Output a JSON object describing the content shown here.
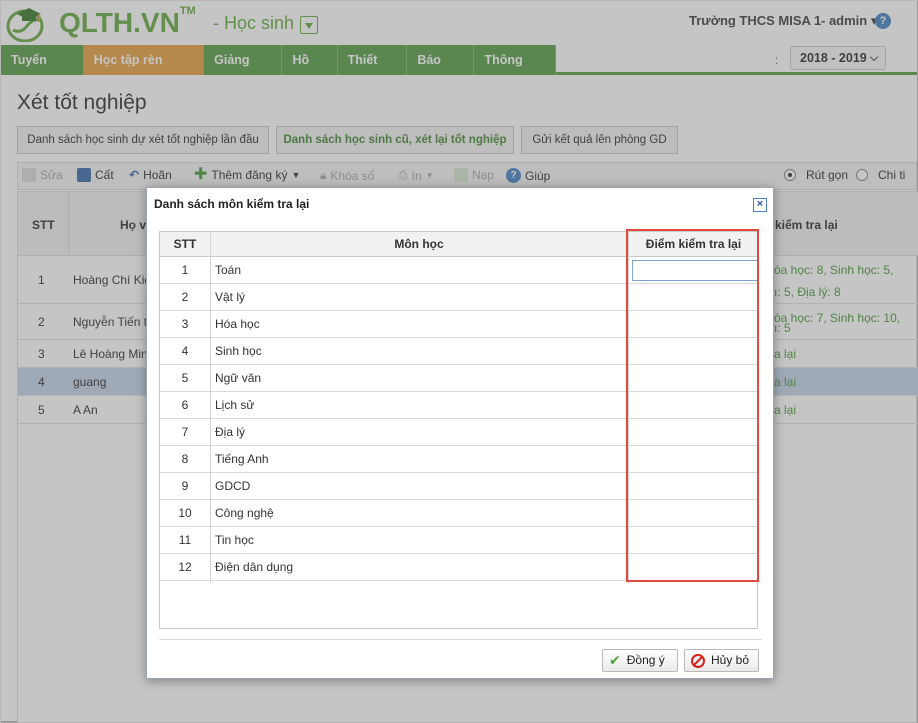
{
  "header": {
    "logo_text": "QLTH.VN",
    "logo_tm": "TM",
    "module": "- Học sinh",
    "school": "Trường THCS MISA 1",
    "user": "- admin ▾",
    "help": "?"
  },
  "nav": {
    "tabs": [
      "Tuyển sinh",
      "Học tập rèn luyện",
      "Giảng dạy",
      "Hồ sơ",
      "Thiết lập",
      "Báo cáo",
      "Thông báo"
    ],
    "active_index": 1,
    "year_colon": ":",
    "year": "2018 - 2019"
  },
  "page_title": "Xét tốt nghiệp",
  "top_buttons": [
    "Danh sách học sinh dự xét tốt nghiệp lần đầu",
    "Danh sách học sinh cũ, xét lại tốt nghiệp",
    "Gửi kết quả lên phòng GD"
  ],
  "toolbar": {
    "edit": "Sửa",
    "save": "Cất",
    "undo": "Hoãn",
    "add": "Thêm đăng ký",
    "lock": "Khóa số",
    "print": "In",
    "import": "Nạp",
    "help": "Giúp",
    "compact": "Rút gọn",
    "detail": "Chi ti"
  },
  "background_table": {
    "col_stt": "STT",
    "col_name": "Họ v",
    "col_exam": "kiểm tra lại",
    "rows": [
      {
        "stt": "1",
        "name": "Hoàng Chí Kiê",
        "exam_1": "óa học: 8, Sinh học: 5,",
        "exam_2": "ı: 5, Địa lý: 8"
      },
      {
        "stt": "2",
        "name": "Nguyễn Tiến t",
        "exam_1": "óa học: 7, Sinh học: 10,",
        "exam_2": "ı: 5"
      },
      {
        "stt": "3",
        "name": "Lê Hoàng Min",
        "exam_1": "a lại",
        "exam_2": ""
      },
      {
        "stt": "4",
        "name": "guang",
        "exam_1": "a lại",
        "exam_2": ""
      },
      {
        "stt": "5",
        "name": "A An",
        "exam_1": "a lại",
        "exam_2": ""
      }
    ]
  },
  "modal": {
    "title": "Danh sách môn kiểm tra lại",
    "close": "×",
    "columns": {
      "stt": "STT",
      "subject": "Môn học",
      "score": "Điểm kiểm tra lại"
    },
    "subjects": [
      {
        "stt": "1",
        "name": "Toán"
      },
      {
        "stt": "2",
        "name": "Vật lý"
      },
      {
        "stt": "3",
        "name": "Hóa học"
      },
      {
        "stt": "4",
        "name": "Sinh học"
      },
      {
        "stt": "5",
        "name": "Ngữ văn"
      },
      {
        "stt": "6",
        "name": "Lịch sử"
      },
      {
        "stt": "7",
        "name": "Địa lý"
      },
      {
        "stt": "8",
        "name": "Tiếng Anh"
      },
      {
        "stt": "9",
        "name": "GDCD"
      },
      {
        "stt": "10",
        "name": "Công nghệ"
      },
      {
        "stt": "11",
        "name": "Tin học"
      },
      {
        "stt": "12",
        "name": "Điện dân dụng"
      }
    ],
    "ok": "Đồng ý",
    "cancel": "Hủy bỏ"
  },
  "colors": {
    "brand_green": "#6aab46",
    "nav_green": "#5aa04a",
    "nav_active": "#e7a244",
    "highlight_red": "#e04a3c"
  }
}
